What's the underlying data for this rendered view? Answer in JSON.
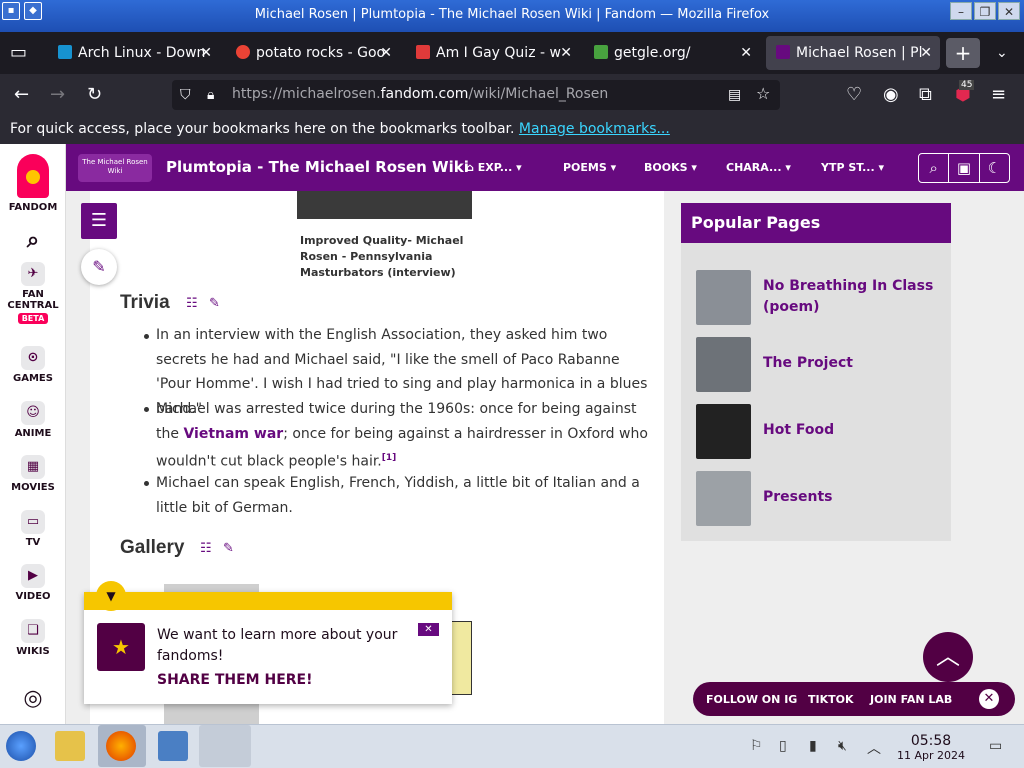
{
  "window": {
    "title": "Michael Rosen | Plumtopia - The Michael Rosen Wiki | Fandom — Mozilla Firefox"
  },
  "tabs": [
    {
      "label": "Arch Linux - Down",
      "color": "#1793d1"
    },
    {
      "label": "potato rocks - Goo",
      "color": "#ea4335"
    },
    {
      "label": "Am I Gay Quiz - w",
      "color": "#e03a3a"
    },
    {
      "label": "getgle.org/",
      "color": "#48a23f"
    },
    {
      "label": "Michael Rosen | Pl",
      "color": "#670a7f"
    }
  ],
  "newtab_label": "+",
  "urlbar": {
    "prefix": "https://michaelrosen.",
    "domain": "fandom.com",
    "suffix": "/wiki/Michael_Rosen"
  },
  "extension_badge": "45",
  "bookmarks": {
    "text": "For quick access, place your bookmarks here on the bookmarks toolbar.",
    "link": "Manage bookmarks..."
  },
  "rail": {
    "fandom": "FANDOM",
    "fan_central": "FAN CENTRAL",
    "beta": "BETA",
    "games": "GAMES",
    "anime": "ANIME",
    "movies": "MOVIES",
    "tv": "TV",
    "video": "VIDEO",
    "wikis": "WIKIS"
  },
  "wiki": {
    "logo_text": "The Michael Rosen Wiki",
    "name": "Plumtopia - The Michael Rosen Wiki",
    "nav": [
      "EXP...",
      "POEMS",
      "BOOKS",
      "CHARA...",
      "YTP ST..."
    ]
  },
  "content": {
    "caption": "Improved Quality- Michael Rosen - Pennsylvania Masturbators (interview)",
    "trivia_heading": "Trivia",
    "trivia1": "In an interview with the English Association, they asked him two secrets he had and Michael said, \"I like the smell of Paco Rabanne 'Pour Homme'. I wish I had tried to sing and play harmonica in a blues band.\"",
    "trivia2_pre": "Michael was arrested twice during the 1960s: once for being against the ",
    "trivia2_link": "Vietnam war",
    "trivia2_post": "; once for being against a hairdresser in Oxford who wouldn't cut black people's hair.",
    "trivia2_ref": "[1]",
    "trivia3": "Michael can speak English, French, Yiddish, a little bit of Italian and a little bit of German.",
    "gallery_heading": "Gallery"
  },
  "popular": {
    "heading": "Popular Pages",
    "items": [
      "No Breathing In Class (poem)",
      "The Project",
      "Hot Food",
      "Presents"
    ]
  },
  "survey": {
    "text": "We want to learn more about your fandoms!",
    "link": "SHARE THEM HERE!"
  },
  "follow": {
    "ig": "FOLLOW ON IG",
    "tiktok": "TIKTOK",
    "fanlab": "JOIN FAN LAB"
  },
  "clock": {
    "time": "05:58",
    "date": "11 Apr 2024"
  }
}
